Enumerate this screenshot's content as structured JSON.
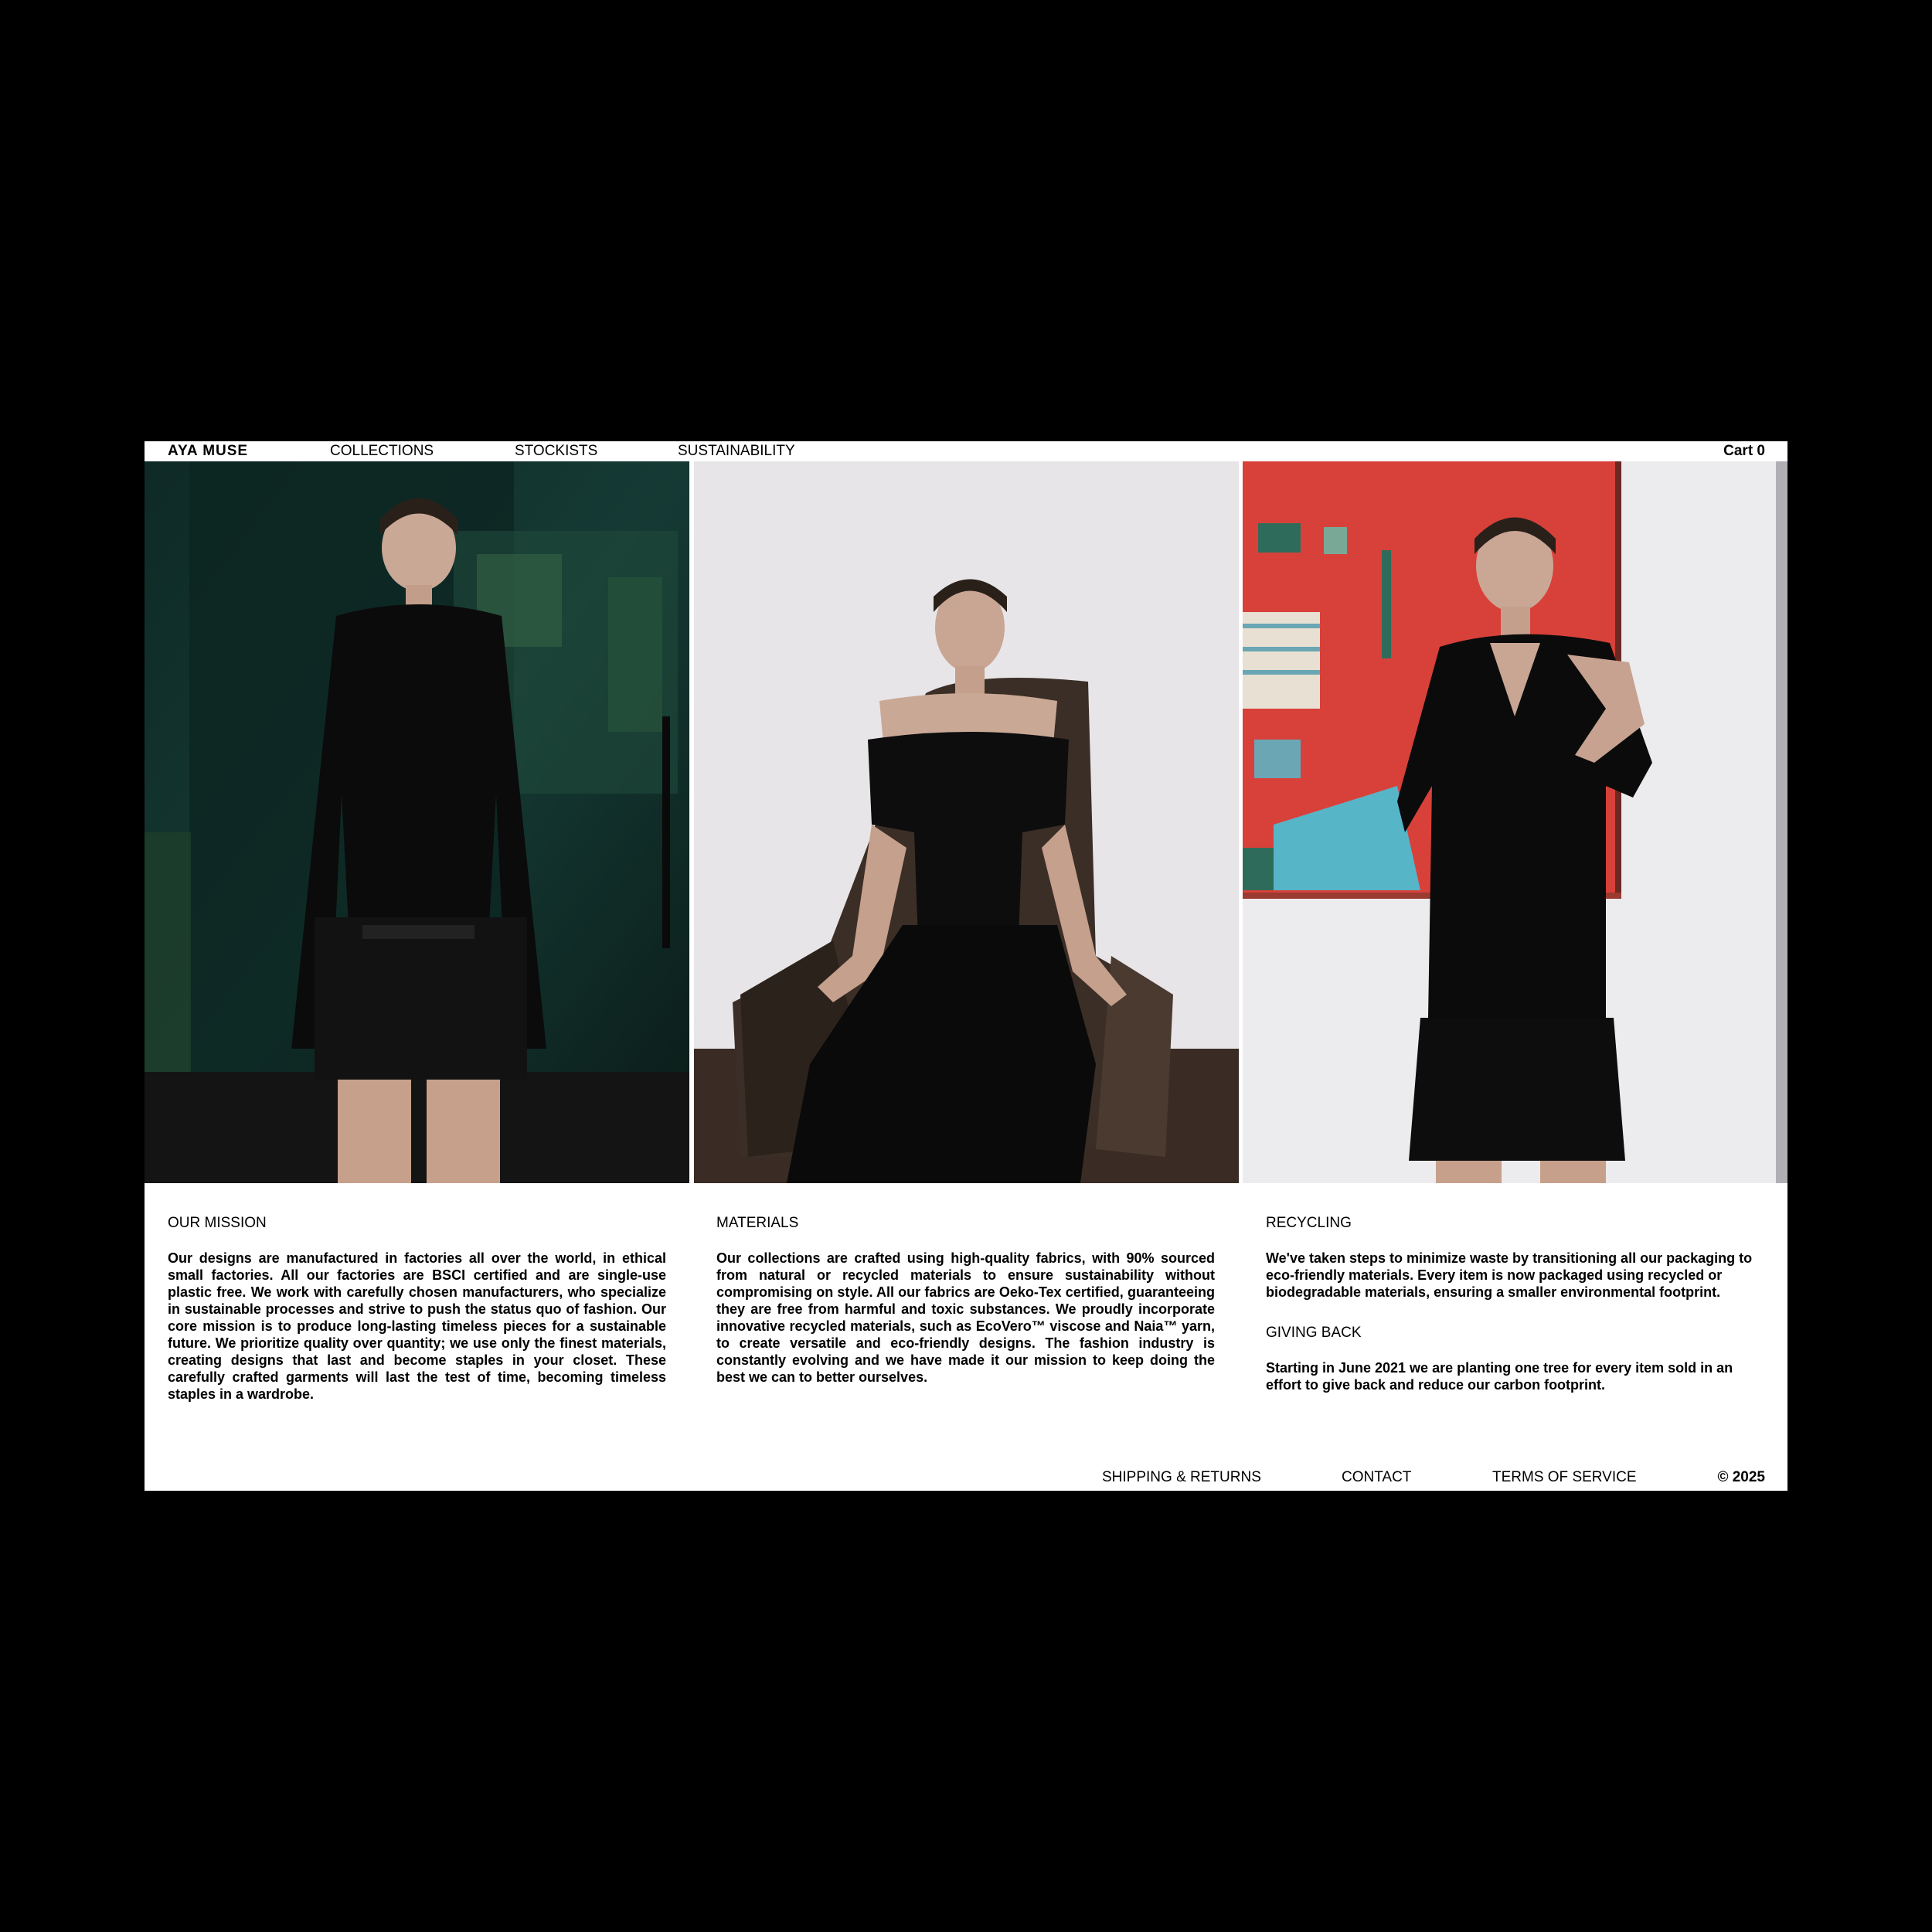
{
  "header": {
    "brand": "AYA MUSE",
    "nav": {
      "collections": "COLLECTIONS",
      "stockists": "STOCKISTS",
      "sustainability": "SUSTAINABILITY"
    },
    "cart": "Cart 0"
  },
  "sections": {
    "mission": {
      "title": "OUR MISSION",
      "body": "Our designs are manufactured in factories all over the world, in ethical small factories. All our factories are BSCI certified and are single-use plastic free. We work with carefully chosen manufacturers, who specialize in sustainable processes and strive to push the status quo of fashion. Our core mission is to produce long-lasting timeless pieces for a sustainable future. We prioritize quality over quantity; we use only the finest materials, creating designs that last and become staples in your closet. These carefully crafted garments will last the test of time, becoming timeless staples in a wardrobe."
    },
    "materials": {
      "title": "MATERIALS",
      "body": "Our collections are crafted using high-quality fabrics, with 90% sourced from natural or recycled materials to ensure sustainability without compromising on style. All our fabrics are Oeko-Tex certified, guaranteeing they are free from harmful and toxic substances. We proudly incorporate innovative recycled materials, such as EcoVero™ viscose and Naia™ yarn, to create versatile and eco-friendly designs. The fashion industry is constantly evolving and we have made it our mission to keep doing the best we can to better ourselves."
    },
    "recycling": {
      "title": "RECYCLING",
      "body": "We've taken steps to minimize waste by transitioning all our packaging to eco-friendly materials. Every item is now packaged using recycled or biodegradable materials, ensuring a smaller environmental footprint."
    },
    "giving_back": {
      "title": "GIVING BACK",
      "body": "Starting in June 2021 we are planting one tree for every item sold in an effort to give back and reduce our carbon footprint."
    }
  },
  "footer": {
    "shipping": "SHIPPING & RETURNS",
    "contact": "CONTACT",
    "terms": "TERMS OF SERVICE",
    "copyright": "© 2025"
  },
  "colors": {
    "page_background": "#000000",
    "site_background": "#ffffff",
    "text": "#000000"
  }
}
